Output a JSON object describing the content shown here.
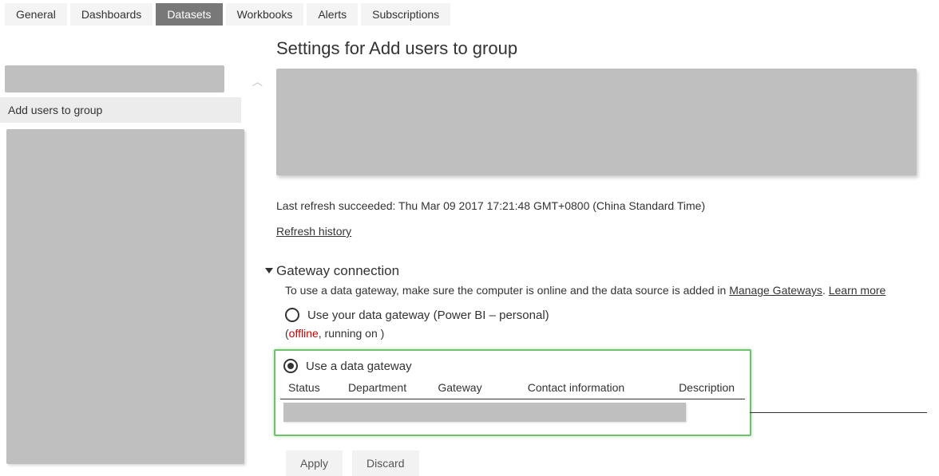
{
  "tabs": {
    "general": "General",
    "dashboards": "Dashboards",
    "datasets": "Datasets",
    "workbooks": "Workbooks",
    "alerts": "Alerts",
    "subscriptions": "Subscriptions"
  },
  "sidebar": {
    "selected_item": "Add users to group"
  },
  "content": {
    "title": "Settings for Add users to group",
    "last_refresh": "Last refresh succeeded: Thu Mar 09 2017 17:21:48 GMT+0800 (China Standard Time)",
    "refresh_history": "Refresh history",
    "section_title": "Gateway connection",
    "section_desc_pre": "To use a data gateway, make sure the computer is online and the data source is added in ",
    "manage_gateways": "Manage Gateways",
    "learn_more": "Learn more",
    "radio_personal": "Use your data gateway (Power BI – personal)",
    "offline_pre": "(",
    "offline": "offline",
    "offline_post": ", running on )",
    "radio_data_gw": "Use a data gateway",
    "columns": {
      "status": "Status",
      "department": "Department",
      "gateway": "Gateway",
      "contact": "Contact information",
      "description": "Description"
    },
    "apply": "Apply",
    "discard": "Discard"
  }
}
